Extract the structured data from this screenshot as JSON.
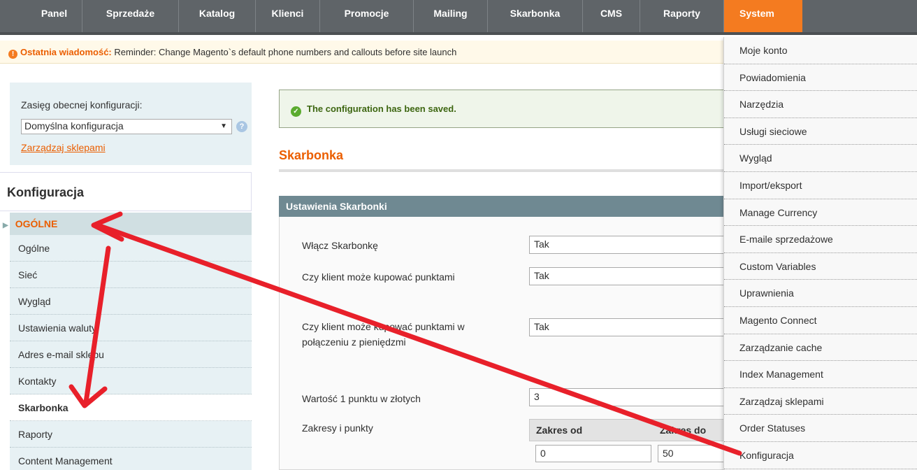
{
  "topnav": {
    "items": [
      "Panel",
      "Sprzedaże",
      "Katalog",
      "Klienci",
      "Promocje",
      "Mailing",
      "Skarbonka",
      "CMS",
      "Raporty",
      "System"
    ],
    "active_color": "#f47b20"
  },
  "notice": {
    "label": "Ostatnia wiadomość:",
    "text": "Reminder: Change Magento`s default phone numbers and callouts before site launch"
  },
  "scope": {
    "label": "Zasięg obecnej konfiguracji:",
    "selected": "Domyślna konfiguracja",
    "manage_link": "Zarządzaj sklepami"
  },
  "sidebar": {
    "title": "Konfiguracja",
    "group": "OGÓLNE",
    "items": [
      "Ogólne",
      "Sieć",
      "Wygląd",
      "Ustawienia waluty",
      "Adres e-mail sklepu",
      "Kontakty",
      "Skarbonka",
      "Raporty",
      "Content Management"
    ],
    "active": "Skarbonka"
  },
  "messages": {
    "success": "The configuration has been saved."
  },
  "main": {
    "heading": "Skarbonka",
    "fieldset_title": "Ustawienia Skarbonki",
    "fields": [
      {
        "label": "Włącz Skarbonkę",
        "value": "Tak"
      },
      {
        "label": "Czy klient może kupować punktami",
        "value": "Tak"
      },
      {
        "label": "Czy klient może kupować punktami w połączeniu z pieniędzmi",
        "value": "Tak"
      },
      {
        "label": "Wartość 1 punktu w złotych",
        "value": "3"
      },
      {
        "label": "Zakresy i punkty",
        "value": ""
      }
    ],
    "ranges": {
      "col_from": "Zakres od",
      "col_to": "Zakres do",
      "row1_from": "0",
      "row1_to": "50"
    }
  },
  "system_menu": {
    "items": [
      "Moje konto",
      "Powiadomienia",
      "Narzędzia",
      "Usługi sieciowe",
      "Wygląd",
      "Import/eksport",
      "Manage Currency",
      "E-maile sprzedażowe",
      "Custom Variables",
      "Uprawnienia",
      "Magento Connect",
      "Zarządzanie cache",
      "Index Management",
      "Zarządzaj sklepami",
      "Order Statuses",
      "Konfiguracja"
    ]
  },
  "annotation_color": "#e8202a"
}
